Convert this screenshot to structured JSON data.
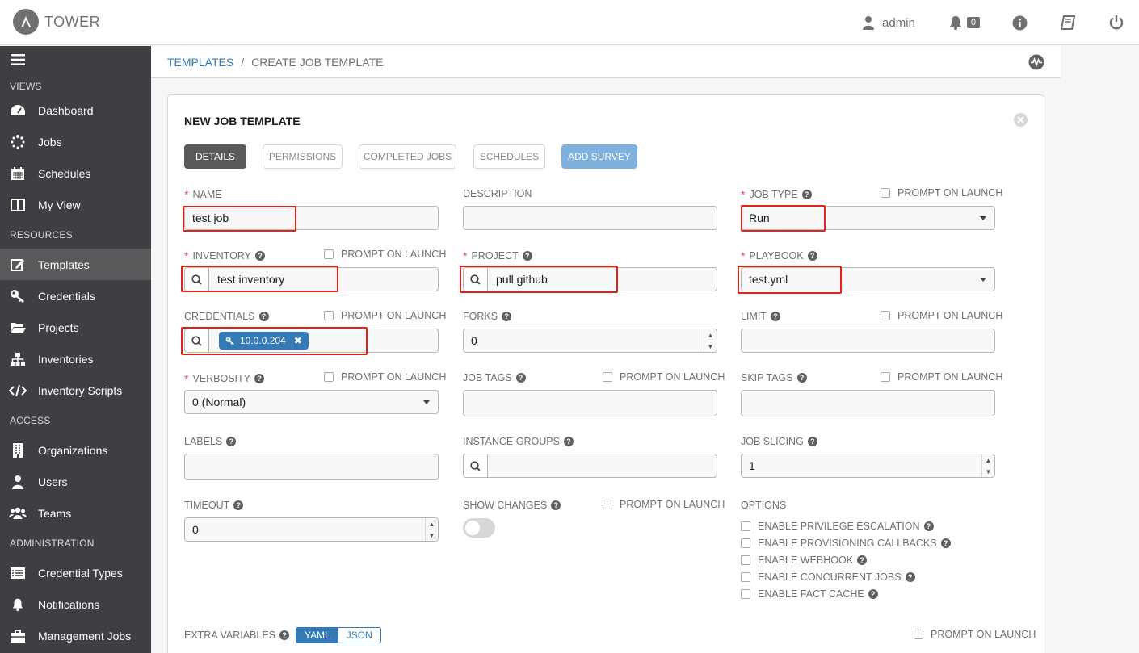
{
  "app": {
    "name": "TOWER"
  },
  "header": {
    "user": "admin",
    "notifications_count": "0"
  },
  "sidebar": {
    "sections": {
      "views": "VIEWS",
      "resources": "RESOURCES",
      "access": "ACCESS",
      "administration": "ADMINISTRATION"
    },
    "items": [
      {
        "label": "Dashboard",
        "icon": "dashboard-icon"
      },
      {
        "label": "Jobs",
        "icon": "spinner-icon"
      },
      {
        "label": "Schedules",
        "icon": "calendar-icon"
      },
      {
        "label": "My View",
        "icon": "columns-icon"
      },
      {
        "label": "Templates",
        "icon": "edit-icon",
        "active": true
      },
      {
        "label": "Credentials",
        "icon": "key-icon"
      },
      {
        "label": "Projects",
        "icon": "folder-icon"
      },
      {
        "label": "Inventories",
        "icon": "sitemap-icon"
      },
      {
        "label": "Inventory Scripts",
        "icon": "code-icon"
      },
      {
        "label": "Organizations",
        "icon": "building-icon"
      },
      {
        "label": "Users",
        "icon": "user-icon"
      },
      {
        "label": "Teams",
        "icon": "users-icon"
      },
      {
        "label": "Credential Types",
        "icon": "list-card-icon"
      },
      {
        "label": "Notifications",
        "icon": "bell-icon"
      },
      {
        "label": "Management Jobs",
        "icon": "briefcase-icon"
      }
    ]
  },
  "breadcrumb": {
    "root": "TEMPLATES",
    "separator": "/",
    "current": "CREATE JOB TEMPLATE"
  },
  "form": {
    "title": "NEW JOB TEMPLATE",
    "tabs": {
      "details": "DETAILS",
      "permissions": "PERMISSIONS",
      "completed_jobs": "COMPLETED JOBS",
      "schedules": "SCHEDULES",
      "add_survey": "ADD SURVEY"
    },
    "prompt_on_launch": "PROMPT ON LAUNCH",
    "name": {
      "label": "NAME",
      "value": "test job"
    },
    "description": {
      "label": "DESCRIPTION",
      "value": ""
    },
    "job_type": {
      "label": "JOB TYPE",
      "value": "Run"
    },
    "inventory": {
      "label": "INVENTORY",
      "value": "test inventory"
    },
    "project": {
      "label": "PROJECT",
      "value": "pull github"
    },
    "playbook": {
      "label": "PLAYBOOK",
      "value": "test.yml"
    },
    "credentials": {
      "label": "CREDENTIALS",
      "chip": "10.0.0.204"
    },
    "forks": {
      "label": "FORKS",
      "value": "0"
    },
    "limit": {
      "label": "LIMIT",
      "value": ""
    },
    "verbosity": {
      "label": "VERBOSITY",
      "value": "0 (Normal)"
    },
    "job_tags": {
      "label": "JOB TAGS",
      "value": ""
    },
    "skip_tags": {
      "label": "SKIP TAGS",
      "value": ""
    },
    "labels": {
      "label": "LABELS",
      "value": ""
    },
    "instance_groups": {
      "label": "INSTANCE GROUPS",
      "value": ""
    },
    "job_slicing": {
      "label": "JOB SLICING",
      "value": "1"
    },
    "timeout": {
      "label": "TIMEOUT",
      "value": "0"
    },
    "show_changes": {
      "label": "SHOW CHANGES",
      "enabled": false
    },
    "options": {
      "label": "OPTIONS",
      "items": [
        "ENABLE PRIVILEGE ESCALATION",
        "ENABLE PROVISIONING CALLBACKS",
        "ENABLE WEBHOOK",
        "ENABLE CONCURRENT JOBS",
        "ENABLE FACT CACHE"
      ]
    },
    "extra_variables": {
      "label": "EXTRA VARIABLES",
      "yaml": "YAML",
      "json": "JSON"
    }
  },
  "colors": {
    "sidebar": "#3d3f42",
    "active_item": "#58595b",
    "link": "#337ab7",
    "highlight": "#e2231a",
    "required": "#d9534f"
  }
}
